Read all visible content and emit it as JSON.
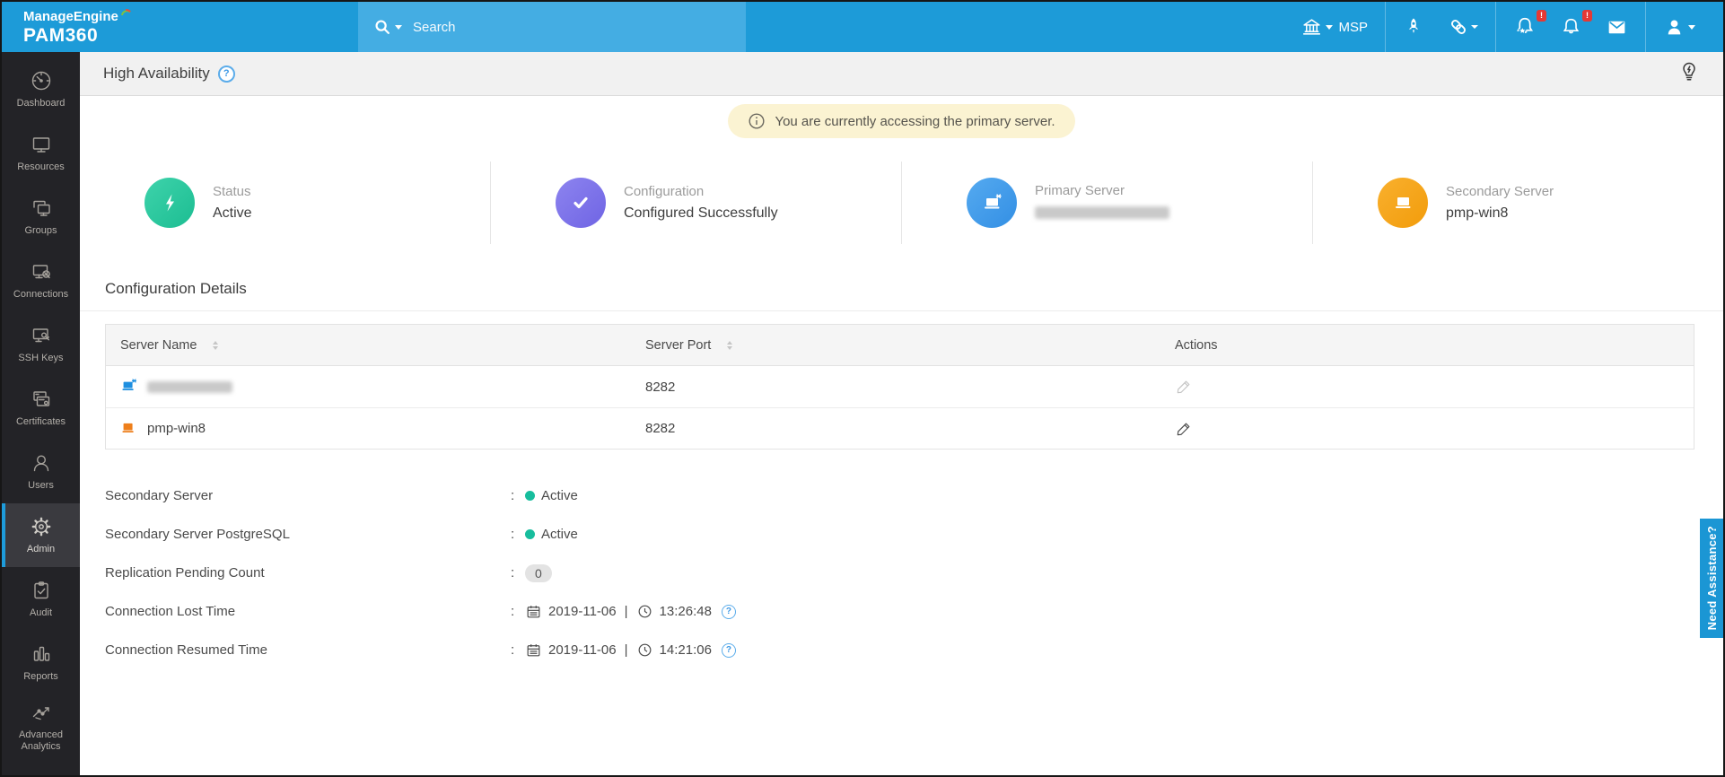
{
  "topbar": {
    "brand": {
      "line1": "ManageEngine",
      "line2": "PAM360"
    },
    "search": {
      "placeholder": "Search",
      "value": ""
    },
    "msp_label": "MSP",
    "badge_text": "!",
    "icons": [
      "search-icon",
      "organization-icon",
      "rocket-icon",
      "link-icon",
      "alert-star-icon",
      "alert-bell-icon",
      "mail-icon",
      "user-icon"
    ]
  },
  "sidebar": {
    "items": [
      {
        "label": "Dashboard",
        "icon": "dashboard-icon",
        "active": false
      },
      {
        "label": "Resources",
        "icon": "resources-icon",
        "active": false
      },
      {
        "label": "Groups",
        "icon": "groups-icon",
        "active": false
      },
      {
        "label": "Connections",
        "icon": "connections-icon",
        "active": false
      },
      {
        "label": "SSH Keys",
        "icon": "ssh-keys-icon",
        "active": false
      },
      {
        "label": "Certificates",
        "icon": "certificates-icon",
        "active": false
      },
      {
        "label": "Users",
        "icon": "users-icon",
        "active": false
      },
      {
        "label": "Admin",
        "icon": "admin-gear-icon",
        "active": true
      },
      {
        "label": "Audit",
        "icon": "audit-icon",
        "active": false
      },
      {
        "label": "Reports",
        "icon": "reports-icon",
        "active": false
      },
      {
        "label": "Advanced Analytics",
        "icon": "advanced-analytics-icon",
        "active": false
      }
    ]
  },
  "page_header": {
    "title": "High Availability",
    "help_icon": "help-icon",
    "tip_icon": "lightbulb-icon"
  },
  "banner": {
    "text": "You are currently accessing the primary server.",
    "icon": "info-icon"
  },
  "cards": [
    {
      "label": "Status",
      "value": "Active",
      "icon": "lightning-icon",
      "color": "#22c79b"
    },
    {
      "label": "Configuration",
      "value": "Configured Successfully",
      "icon": "check-icon",
      "color": "#7a70e8"
    },
    {
      "label": "Primary Server",
      "value": "",
      "redacted": true,
      "icon": "laptop-primary-icon",
      "color": "#3e9ce9"
    },
    {
      "label": "Secondary Server",
      "value": "pmp-win8",
      "icon": "laptop-icon",
      "color": "#f6a41c"
    }
  ],
  "section": {
    "title": "Configuration Details"
  },
  "table": {
    "columns": [
      {
        "label": "Server Name",
        "sortable": true
      },
      {
        "label": "Server Port",
        "sortable": true
      },
      {
        "label": "Actions",
        "sortable": false
      }
    ],
    "rows": [
      {
        "name": "",
        "redacted": true,
        "icon": "laptop-primary-icon",
        "port": "8282",
        "action": "edit-icon"
      },
      {
        "name": "pmp-win8",
        "redacted": false,
        "icon": "laptop-icon",
        "port": "8282",
        "action": "edit-icon"
      }
    ]
  },
  "details": [
    {
      "label": "Secondary Server",
      "type": "status",
      "value": "Active"
    },
    {
      "label": "Secondary Server PostgreSQL",
      "type": "status",
      "value": "Active"
    },
    {
      "label": "Replication Pending Count",
      "type": "badge",
      "value": "0"
    },
    {
      "label": "Connection Lost Time",
      "type": "datetime",
      "date": "2019-11-06",
      "time": "13:26:48"
    },
    {
      "label": "Connection Resumed Time",
      "type": "datetime",
      "date": "2019-11-06",
      "time": "14:21:06"
    }
  ],
  "assist_tab": {
    "label": "Need Assistance?"
  },
  "ui": {
    "colon": ":",
    "pipe": "|",
    "question_mark": "?"
  },
  "colors": {
    "topbar_blue": "#1d9bd8",
    "search_blue": "#44ade3",
    "sidebar_bg": "#232327",
    "active_accent": "#1e9cdb",
    "banner_bg": "#fbf3d2",
    "status_green": "#17bd9d",
    "badge_red": "#e53935",
    "card_green": "#22c79b",
    "card_purple": "#7a70e8",
    "card_blue": "#3e9ce9",
    "card_orange": "#f6a41c"
  }
}
